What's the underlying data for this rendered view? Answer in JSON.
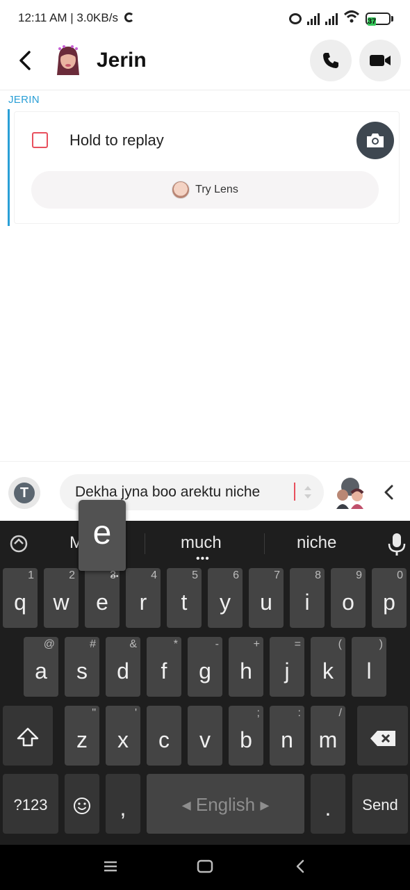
{
  "status_bar": {
    "time_speed": "12:11 AM | 3.0KB/s",
    "battery": "37"
  },
  "header": {
    "contact_name": "Jerin",
    "back_icon": "chevron-left-icon",
    "call_icon": "phone-icon",
    "video_icon": "video-camera-icon"
  },
  "chat": {
    "sender_label": "JERIN",
    "snap": {
      "status_text": "Hold to replay",
      "camera_icon": "camera-icon",
      "try_lens_label": "Try Lens"
    }
  },
  "composer": {
    "message_text": "Dekha jyna boo arektu niche",
    "text_tool_icon": "T"
  },
  "keyboard": {
    "suggestions": [
      "M",
      "much",
      "niche"
    ],
    "popup_key": "e",
    "row1": [
      {
        "key": "q",
        "hint": "1"
      },
      {
        "key": "w",
        "hint": "2"
      },
      {
        "key": "e",
        "hint": "3"
      },
      {
        "key": "r",
        "hint": "4"
      },
      {
        "key": "t",
        "hint": "5"
      },
      {
        "key": "y",
        "hint": "6"
      },
      {
        "key": "u",
        "hint": "7"
      },
      {
        "key": "i",
        "hint": "8"
      },
      {
        "key": "o",
        "hint": "9"
      },
      {
        "key": "p",
        "hint": "0"
      }
    ],
    "row2": [
      {
        "key": "a",
        "hint": "@"
      },
      {
        "key": "s",
        "hint": "#"
      },
      {
        "key": "d",
        "hint": "&"
      },
      {
        "key": "f",
        "hint": "*"
      },
      {
        "key": "g",
        "hint": "-"
      },
      {
        "key": "h",
        "hint": "+"
      },
      {
        "key": "j",
        "hint": "="
      },
      {
        "key": "k",
        "hint": "("
      },
      {
        "key": "l",
        "hint": ")"
      }
    ],
    "row3": [
      {
        "key": "z",
        "hint": "\""
      },
      {
        "key": "x",
        "hint": "'"
      },
      {
        "key": "c",
        "hint": ""
      },
      {
        "key": "v",
        "hint": ""
      },
      {
        "key": "b",
        "hint": ";"
      },
      {
        "key": "n",
        "hint": ":"
      },
      {
        "key": "m",
        "hint": "/"
      }
    ],
    "symbols_label": "?123",
    "comma_label": ",",
    "space_label": "◂ English ▸",
    "period_label": ".",
    "send_label": "Send"
  },
  "colors": {
    "accent_blue": "#2a9fd6",
    "snap_red": "#e84f5d",
    "keyboard_bg": "#1e1e1e",
    "key_bg": "#444444"
  }
}
